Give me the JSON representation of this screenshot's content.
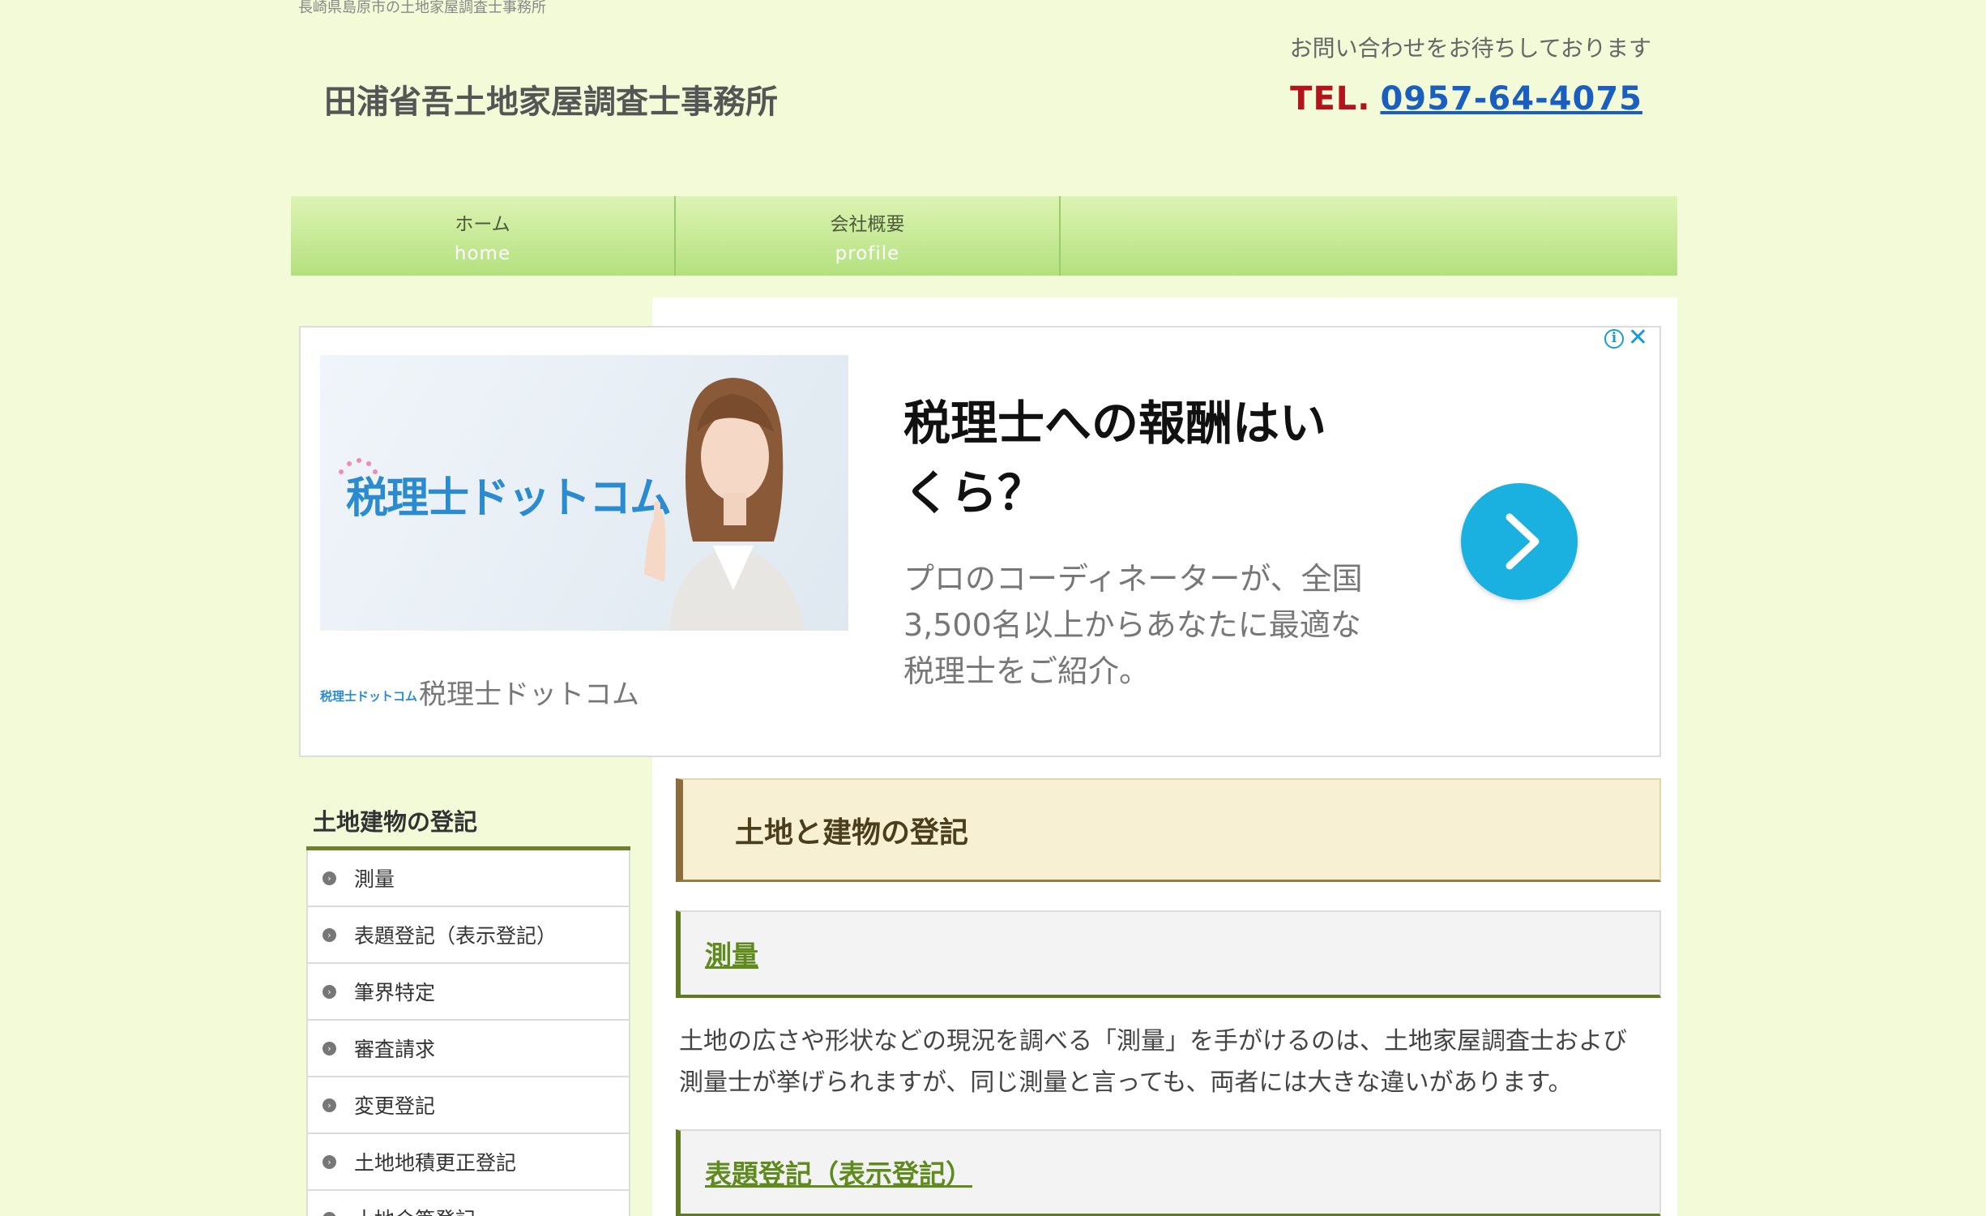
{
  "header": {
    "tagline": "長崎県島原市の土地家屋調査士事務所",
    "site_title": "田浦省吾土地家屋調査士事務所",
    "contact_message": "お問い合わせをお待ちしております",
    "tel_label": "TEL.",
    "tel_number": "0957-64-4075"
  },
  "nav": {
    "items": [
      {
        "label_jp": "ホーム",
        "label_en": "home"
      },
      {
        "label_jp": "会社概要",
        "label_en": "profile"
      }
    ]
  },
  "ad": {
    "logo_text": "税理士ドットコム",
    "headline": "税理士への報酬はいくら？",
    "body": "プロのコーディネーターが、全国3,500名以上からあなたに最適な税理士をご紹介。",
    "advertiser": "税理士ドットコム",
    "info_glyph": "i",
    "close_glyph": "✕",
    "accent_color": "#1ab0e0"
  },
  "sidebar": {
    "heading": "土地建物の登記",
    "items": [
      {
        "label": "測量"
      },
      {
        "label": "表題登記（表示登記）"
      },
      {
        "label": "筆界特定"
      },
      {
        "label": "審査請求"
      },
      {
        "label": "変更登記"
      },
      {
        "label": "土地地積更正登記"
      },
      {
        "label": "土地合筆登記"
      }
    ]
  },
  "main": {
    "page_heading": "土地と建物の登記",
    "sections": [
      {
        "title": "測量",
        "body": "土地の広さや形状などの現況を調べる「測量」を手がけるのは、土地家屋調査士および測量士が挙げられますが、同じ測量と言っても、両者には大きな違いがあります。"
      },
      {
        "title": "表題登記（表示登記）"
      }
    ]
  }
}
